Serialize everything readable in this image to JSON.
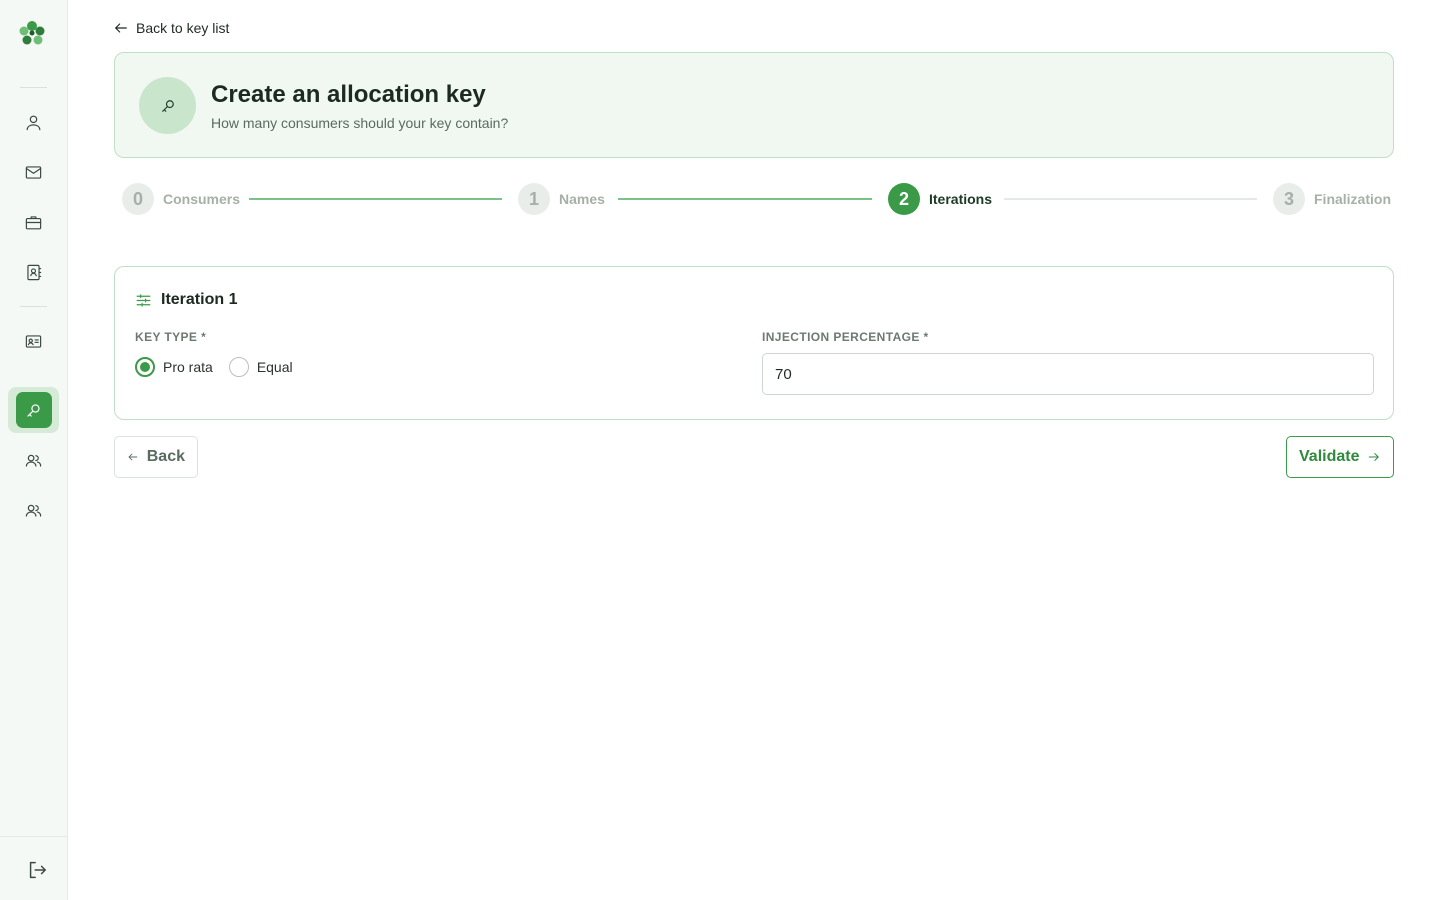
{
  "nav": {
    "back_link": "Back to key list"
  },
  "sidebar": {
    "items": [
      {
        "icon": "user-icon"
      },
      {
        "icon": "mail-icon"
      },
      {
        "icon": "briefcase-icon"
      },
      {
        "icon": "contact-book-icon"
      },
      {
        "icon": "id-card-icon"
      },
      {
        "icon": "key-icon",
        "active": true
      },
      {
        "icon": "users-icon"
      },
      {
        "icon": "users-icon"
      }
    ],
    "logout_icon": "logout-icon"
  },
  "header": {
    "title": "Create an allocation key",
    "subtitle": "How many consumers should your key contain?"
  },
  "stepper": {
    "steps": [
      {
        "number": "0",
        "label": "Consumers",
        "state": "done"
      },
      {
        "number": "1",
        "label": "Names",
        "state": "done"
      },
      {
        "number": "2",
        "label": "Iterations",
        "state": "current"
      },
      {
        "number": "3",
        "label": "Finalization",
        "state": "todo"
      }
    ]
  },
  "iteration": {
    "title": "Iteration 1",
    "key_type_label": "KEY TYPE *",
    "key_type_options": [
      "Pro rata",
      "Equal"
    ],
    "key_type_selected": "Pro rata",
    "injection_label": "INJECTION PERCENTAGE *",
    "injection_value": "70"
  },
  "actions": {
    "back_label": "Back",
    "validate_label": "Validate"
  },
  "colors": {
    "accent": "#3a9a48",
    "accent_light": "#c9e6cd",
    "card_bg": "#f1f8f2",
    "border": "#bfe0c4"
  }
}
